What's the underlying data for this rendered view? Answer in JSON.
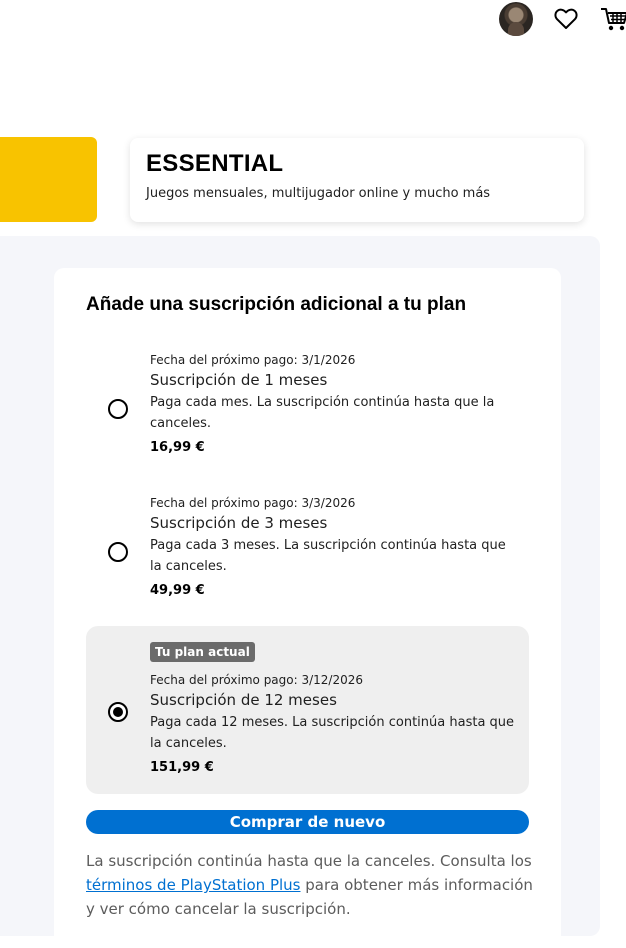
{
  "header": {
    "avatar_icon": "user-avatar",
    "wishlist_icon": "heart-icon",
    "cart_icon": "cart-icon"
  },
  "plan": {
    "title": "ESSENTIAL",
    "subtitle": "Juegos mensuales, multijugador online y mucho más",
    "accent_color": "#f8c300"
  },
  "section": {
    "title": "Añade una suscripción adicional a tu plan"
  },
  "options": [
    {
      "next_payment": "Fecha del próximo pago: 3/1/2026",
      "name": "Suscripción de 1 meses",
      "description": "Paga cada mes. La suscripción continúa hasta que la canceles.",
      "price": "16,99 €",
      "selected": false
    },
    {
      "next_payment": "Fecha del próximo pago: 3/3/2026",
      "name": "Suscripción de 3 meses",
      "description": "Paga cada 3 meses. La suscripción continúa hasta que la canceles.",
      "price": "49,99 €",
      "selected": false
    },
    {
      "badge": "Tu plan actual",
      "next_payment": "Fecha del próximo pago: 3/12/2026",
      "name": "Suscripción de 12 meses",
      "description": "Paga cada 12 meses. La suscripción continúa hasta que la canceles.",
      "price": "151,99 €",
      "selected": true
    }
  ],
  "buy_button": {
    "label": "Comprar de nuevo",
    "color": "#0070d1"
  },
  "footer": {
    "text_before": "La suscripción continúa hasta que la canceles. Consulta los ",
    "link_text": "términos de PlayStation Plus",
    "text_after": " para obtener más información y ver cómo cancelar la suscripción."
  }
}
